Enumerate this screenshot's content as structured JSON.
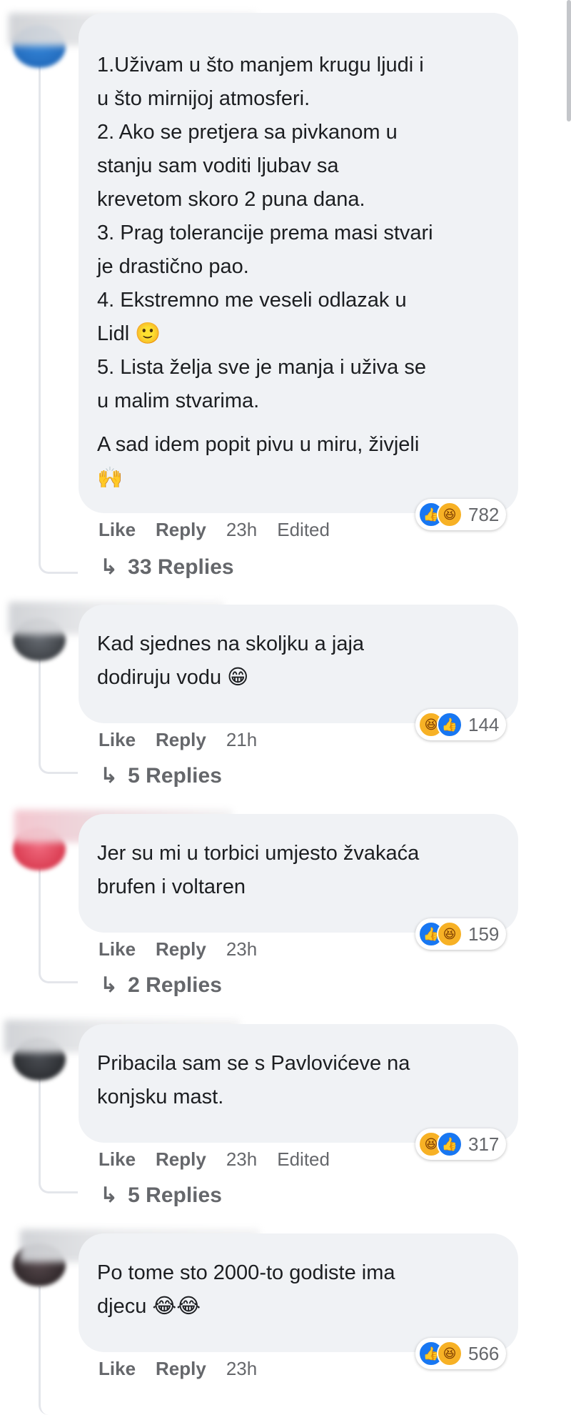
{
  "comments": [
    {
      "text": "1.Uživam u što manjem krugu ljudi i\nu što mirnijoj atmosferi.\n2. Ako se pretjera sa pivkanom u\nstanju sam voditi ljubav sa\nkrevetom skoro 2 puna dana.\n3. Prag tolerancije prema masi stvari\nje drastično pao.\n4. Ekstremno me veseli odlazak u\nLidl 🙂\n5. Lista želja sve je manja i uživa se\nu malim stvarima.",
      "text2": "A sad idem popit pivu u miru, živjeli\n🙌",
      "reaction_count": "782",
      "reactions": [
        "like",
        "haha"
      ],
      "time": "23h",
      "edited": "Edited",
      "replies": "33 Replies"
    },
    {
      "text": "Kad sjednes na skoljku a jaja\ndodiruju vodu 😁",
      "reaction_count": "144",
      "reactions": [
        "haha",
        "like"
      ],
      "time": "21h",
      "edited": "",
      "replies": "5 Replies"
    },
    {
      "text": "Jer su mi u torbici umjesto žvakaća\nbrufen i voltaren",
      "reaction_count": "159",
      "reactions": [
        "like",
        "haha"
      ],
      "time": "23h",
      "edited": "",
      "replies": "2 Replies"
    },
    {
      "text": "Pribacila sam se s Pavlovićeve na\nkonjsku mast.",
      "reaction_count": "317",
      "reactions": [
        "haha",
        "like"
      ],
      "time": "23h",
      "edited": "Edited",
      "replies": "5 Replies"
    },
    {
      "text": "Po tome sto 2000-to godiste ima\ndjecu 😂😂",
      "reaction_count": "566",
      "reactions": [
        "like",
        "haha"
      ],
      "time": "23h",
      "edited": "",
      "replies": ""
    }
  ],
  "actions": {
    "like": "Like",
    "reply": "Reply"
  },
  "reply_arrow": "↳",
  "colors": {
    "bubble": "#f0f2f5",
    "like": "#1877f2",
    "haha": "#f7b125",
    "meta": "#65676b"
  }
}
